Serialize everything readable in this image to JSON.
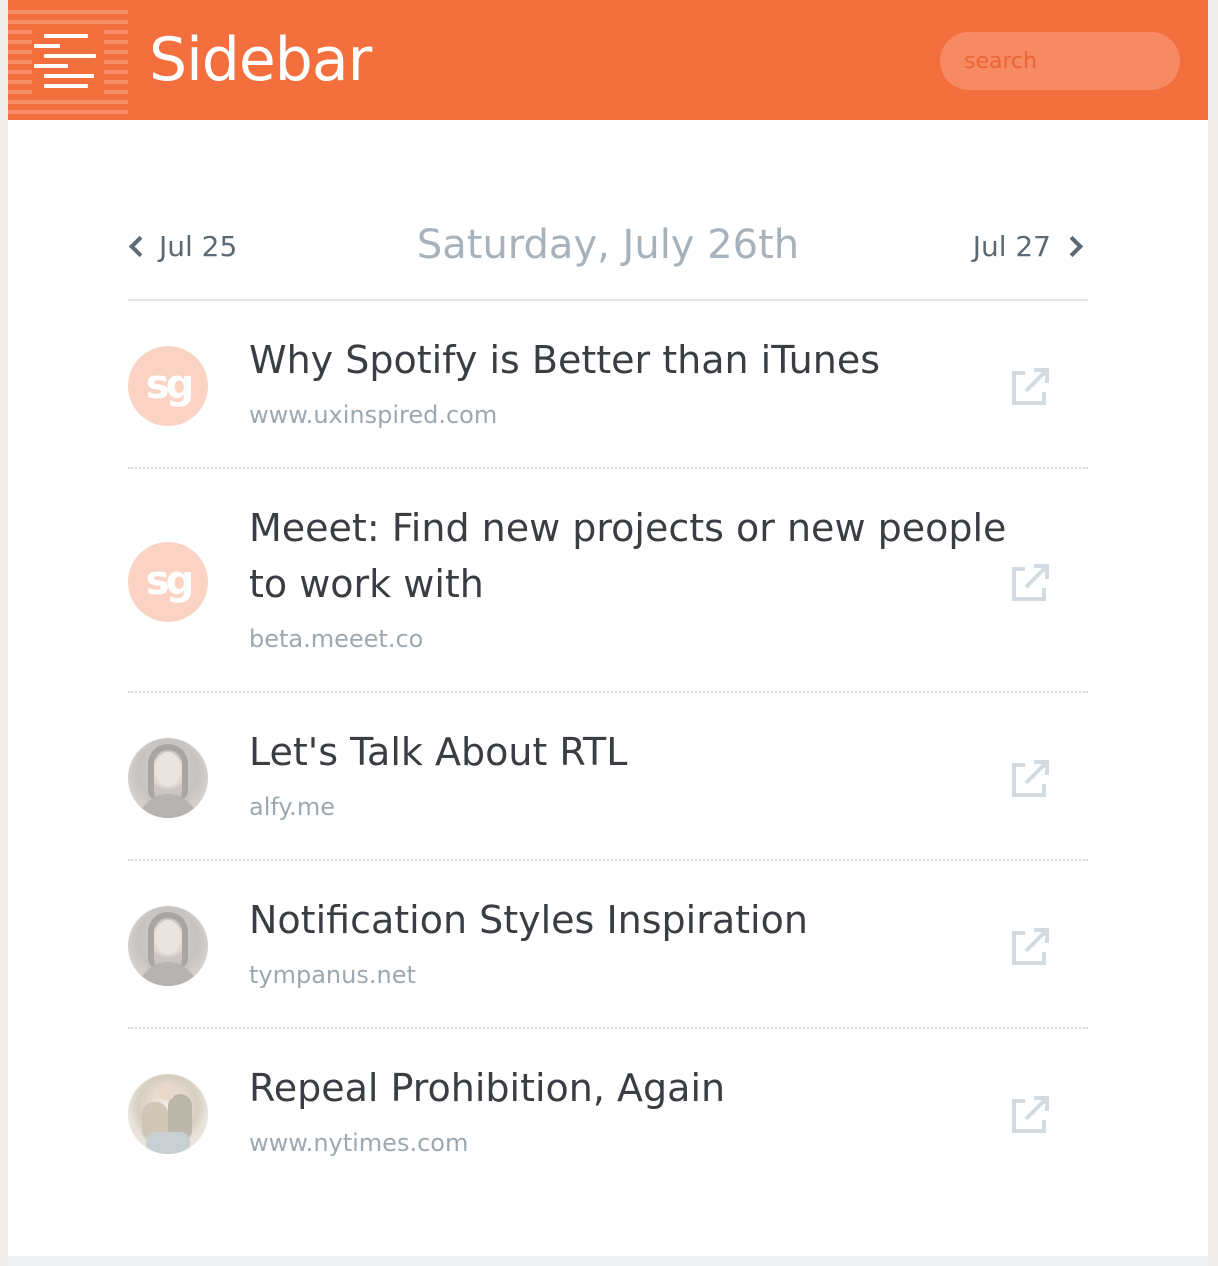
{
  "app": {
    "title": "Sidebar",
    "search_placeholder": "search",
    "brand_color": "#f46f3e"
  },
  "datenav": {
    "prev_label": "Jul 25",
    "current_date": "Saturday, July 26th",
    "next_label": "Jul 27"
  },
  "links": [
    {
      "title": "Why Spotify is Better than iTunes",
      "domain": "www.uxinspired.com",
      "avatar": "sg-logo",
      "avatar_text": "sg",
      "icon": "external-link-icon"
    },
    {
      "title": "Meeet: Find new projects or new people to work with",
      "domain": "beta.meeet.co",
      "avatar": "sg-logo",
      "avatar_text": "sg",
      "icon": "external-link-icon"
    },
    {
      "title": "Let's Talk About RTL",
      "domain": "alfy.me",
      "avatar": "user-photo",
      "icon": "external-link-icon"
    },
    {
      "title": "Notification Styles Inspiration",
      "domain": "tympanus.net",
      "avatar": "user-photo",
      "icon": "external-link-icon"
    },
    {
      "title": "Repeal Prohibition, Again",
      "domain": "www.nytimes.com",
      "avatar": "user-photo-group",
      "icon": "external-link-icon"
    }
  ]
}
